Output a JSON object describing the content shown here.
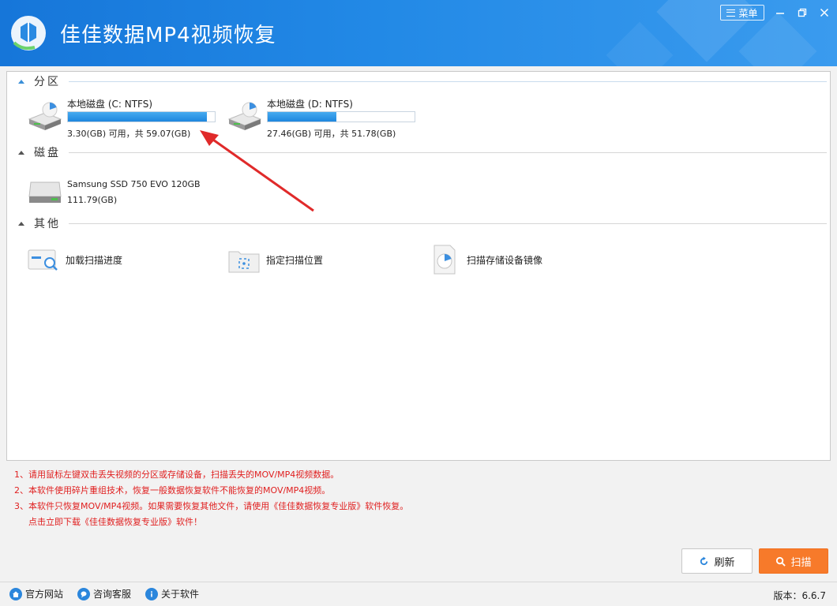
{
  "app": {
    "title": "佳佳数据MP4视频恢复",
    "menu_label": "菜单"
  },
  "colors": {
    "titlebar": "#1e82df",
    "accent": "#2b86dc",
    "note_red": "#e02020",
    "scan_orange": "#f77a2a"
  },
  "sections": {
    "partition": "分区",
    "disk": "磁盘",
    "other": "其他"
  },
  "partitions": [
    {
      "name": "本地磁盘 (C: NTFS)",
      "size": "3.30(GB) 可用，共 59.07(GB)",
      "used_percent": 94.4
    },
    {
      "name": "本地磁盘 (D: NTFS)",
      "size": "27.46(GB) 可用，共 51.78(GB)",
      "used_percent": 47.0
    }
  ],
  "disks": [
    {
      "name": "Samsung SSD 750 EVO 120GB",
      "size": "111.79(GB)"
    }
  ],
  "others": [
    {
      "label": "加载扫描进度",
      "icon": "load-progress-icon"
    },
    {
      "label": "指定扫描位置",
      "icon": "folder-target-icon"
    },
    {
      "label": "扫描存储设备镜像",
      "icon": "disk-image-icon"
    }
  ],
  "notes": [
    "1、请用鼠标左键双击丢失视频的分区或存储设备，扫描丢失的MOV/MP4视频数据。",
    "2、本软件使用碎片重组技术，恢复一般数据恢复软件不能恢复的MOV/MP4视频。",
    "3、本软件只恢复MOV/MP4视频。如果需要恢复其他文件，请使用《佳佳数据恢复专业版》软件恢复。",
    "点击立即下载《佳佳数据恢复专业版》软件！"
  ],
  "buttons": {
    "refresh": "刷新",
    "scan": "扫描"
  },
  "statusbar": {
    "website": "官方网站",
    "support": "咨询客服",
    "about": "关于软件",
    "version": "版本：6.6.7"
  }
}
